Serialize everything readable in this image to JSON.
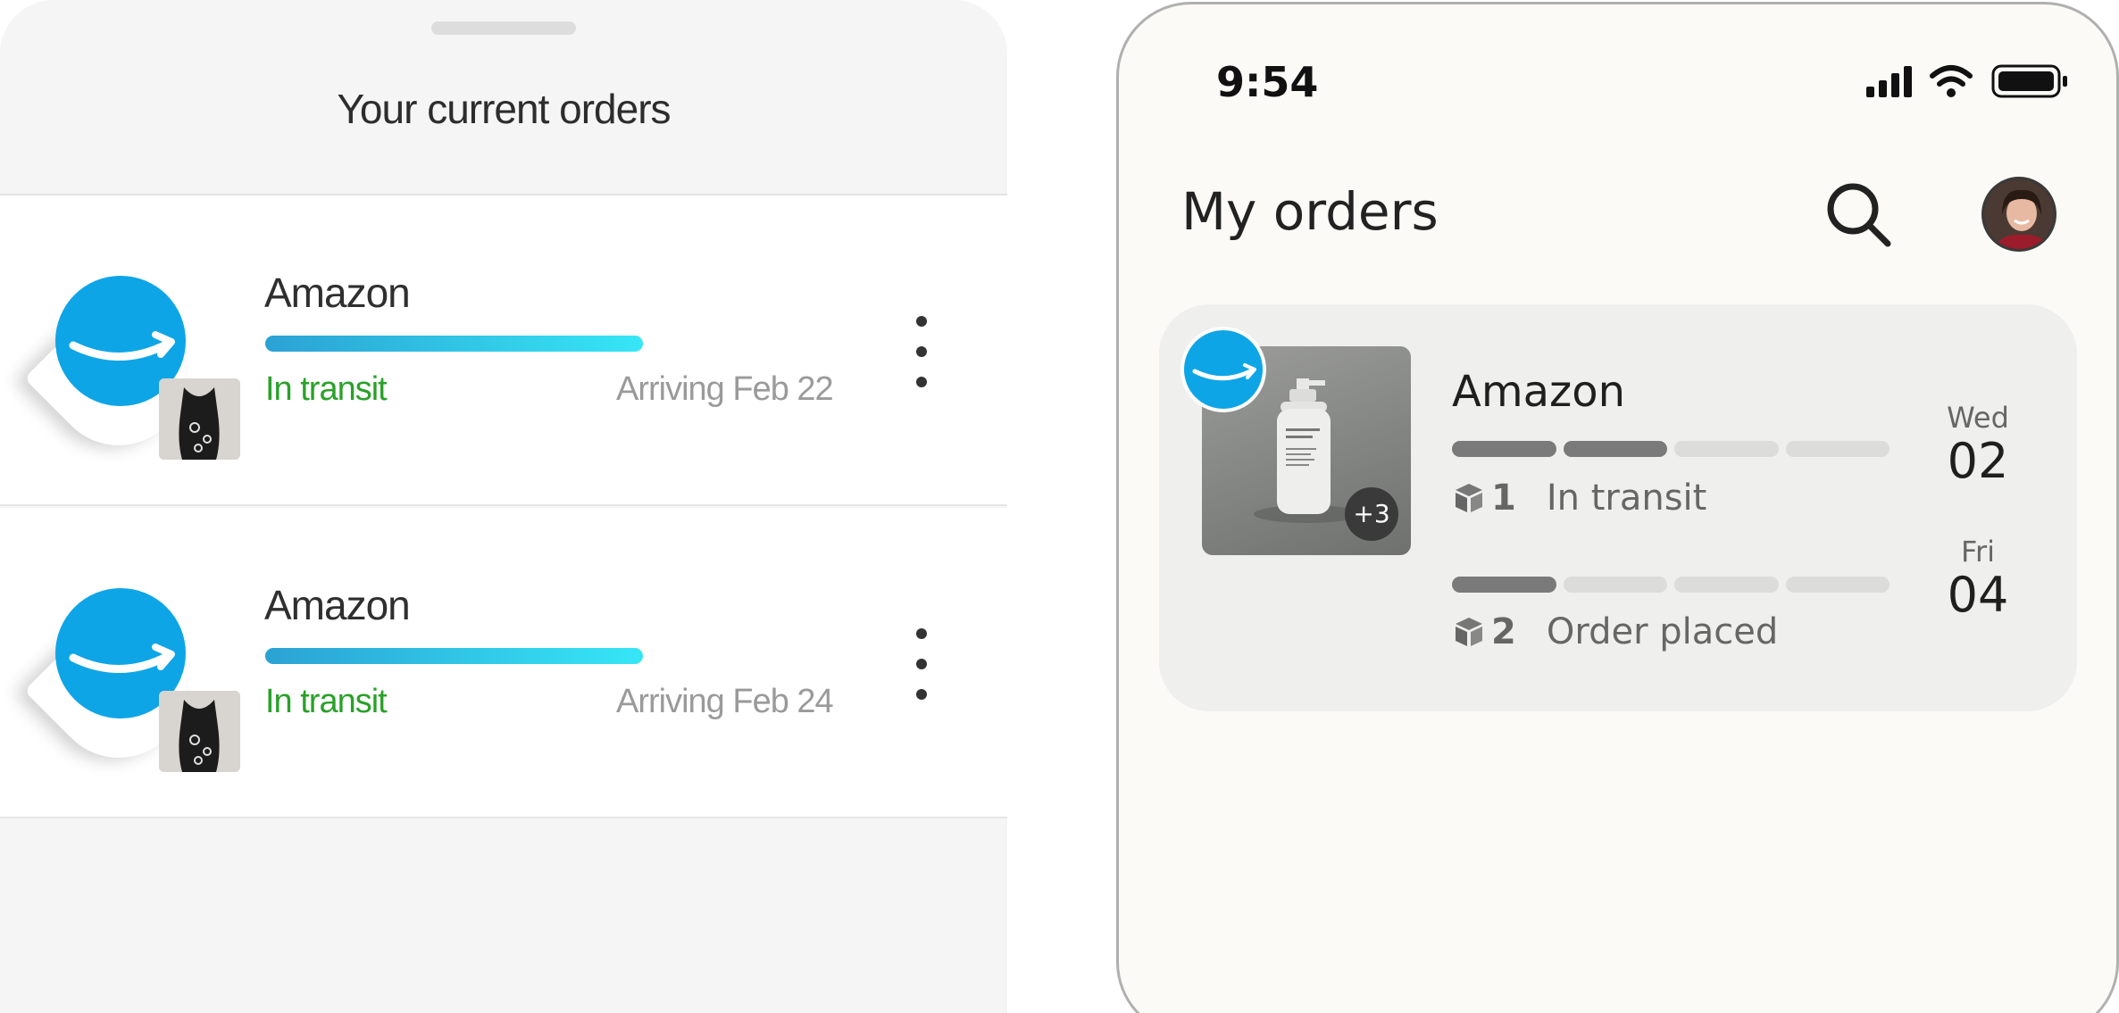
{
  "left_panel": {
    "title": "Your current orders",
    "orders": [
      {
        "merchant": "Amazon",
        "status": "In transit",
        "arrival": "Arriving Feb 22",
        "progress": 1.0
      },
      {
        "merchant": "Amazon",
        "status": "In transit",
        "arrival": "Arriving Feb 24",
        "progress": 1.0
      }
    ]
  },
  "right_panel": {
    "status_bar": {
      "time": "9:54"
    },
    "title": "My orders",
    "order_card": {
      "merchant": "Amazon",
      "extra_items_badge": "+3",
      "packages": [
        {
          "number": "1",
          "status": "In transit",
          "steps_complete": 2,
          "steps_total": 4,
          "day": "Wed",
          "date": "02"
        },
        {
          "number": "2",
          "status": "Order placed",
          "steps_complete": 1,
          "steps_total": 4,
          "day": "Fri",
          "date": "04"
        }
      ]
    }
  },
  "colors": {
    "brand_blue": "#0ea5e6",
    "status_green": "#2aa12a",
    "progress_start": "#2ba2d4",
    "progress_end": "#36e6f6"
  },
  "icons": [
    "amazon-logo-icon",
    "kebab-menu-icon",
    "search-icon",
    "signal-icon",
    "wifi-icon",
    "battery-icon",
    "package-icon"
  ]
}
